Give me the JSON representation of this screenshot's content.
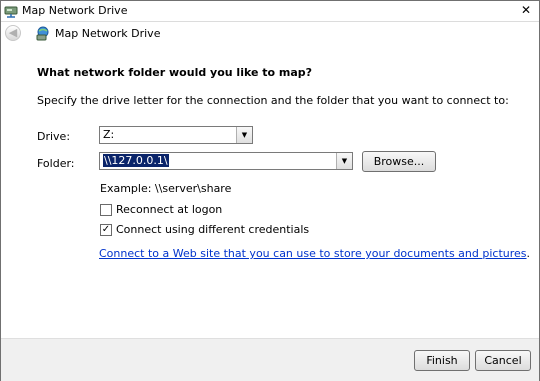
{
  "window": {
    "title": "Map Network Drive",
    "close_glyph": "✕"
  },
  "nav": {
    "back_glyph": "◀",
    "wizard_title": "Map Network Drive"
  },
  "main": {
    "heading": "What network folder would you like to map?",
    "instruction": "Specify the drive letter for the connection and the folder that you want to connect to:",
    "drive_label": "Drive:",
    "drive_value": "Z:",
    "folder_label": "Folder:",
    "folder_value": "\\\\127.0.0.1\\",
    "browse_label": "Browse...",
    "example_text": "Example: \\\\server\\share",
    "reconnect_label": "Reconnect at logon",
    "reconnect_checked": false,
    "credentials_label": "Connect using different credentials",
    "credentials_checked": true,
    "web_link": "Connect to a Web site that you can use to store your documents and pictures",
    "web_link_period": "."
  },
  "footer": {
    "finish_label": "Finish",
    "cancel_label": "Cancel"
  },
  "icons": {
    "dropdown_arrow": "▼",
    "check_mark": "✓"
  }
}
